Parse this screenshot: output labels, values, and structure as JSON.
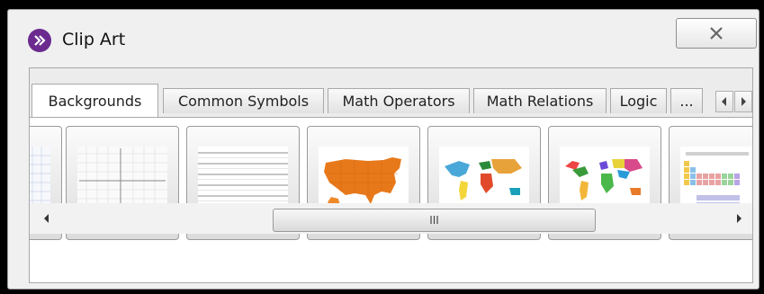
{
  "window": {
    "title": "Clip Art",
    "close_icon": "close-icon"
  },
  "tabs": [
    {
      "label": "Backgrounds",
      "active": true
    },
    {
      "label": "Common Symbols",
      "active": false
    },
    {
      "label": "Math Operators",
      "active": false
    },
    {
      "label": "Math Relations",
      "active": false
    },
    {
      "label": "Logic",
      "active": false
    },
    {
      "label": "...",
      "active": false
    }
  ],
  "tab_scroll": {
    "left_icon": "chevron-left-icon",
    "right_icon": "chevron-right-icon"
  },
  "gallery": {
    "items": [
      {
        "name": "grid-background-thumbnail"
      },
      {
        "name": "coordinate-plane-thumbnail"
      },
      {
        "name": "lined-paper-thumbnail"
      },
      {
        "name": "usa-map-thumbnail"
      },
      {
        "name": "world-map-continents-thumbnail"
      },
      {
        "name": "world-map-countries-thumbnail"
      },
      {
        "name": "periodic-table-thumbnail"
      }
    ]
  },
  "scrollbar": {
    "grip": "III"
  },
  "colors": {
    "app_icon": "#6b2a8e",
    "usa_map": "#e8791a"
  }
}
